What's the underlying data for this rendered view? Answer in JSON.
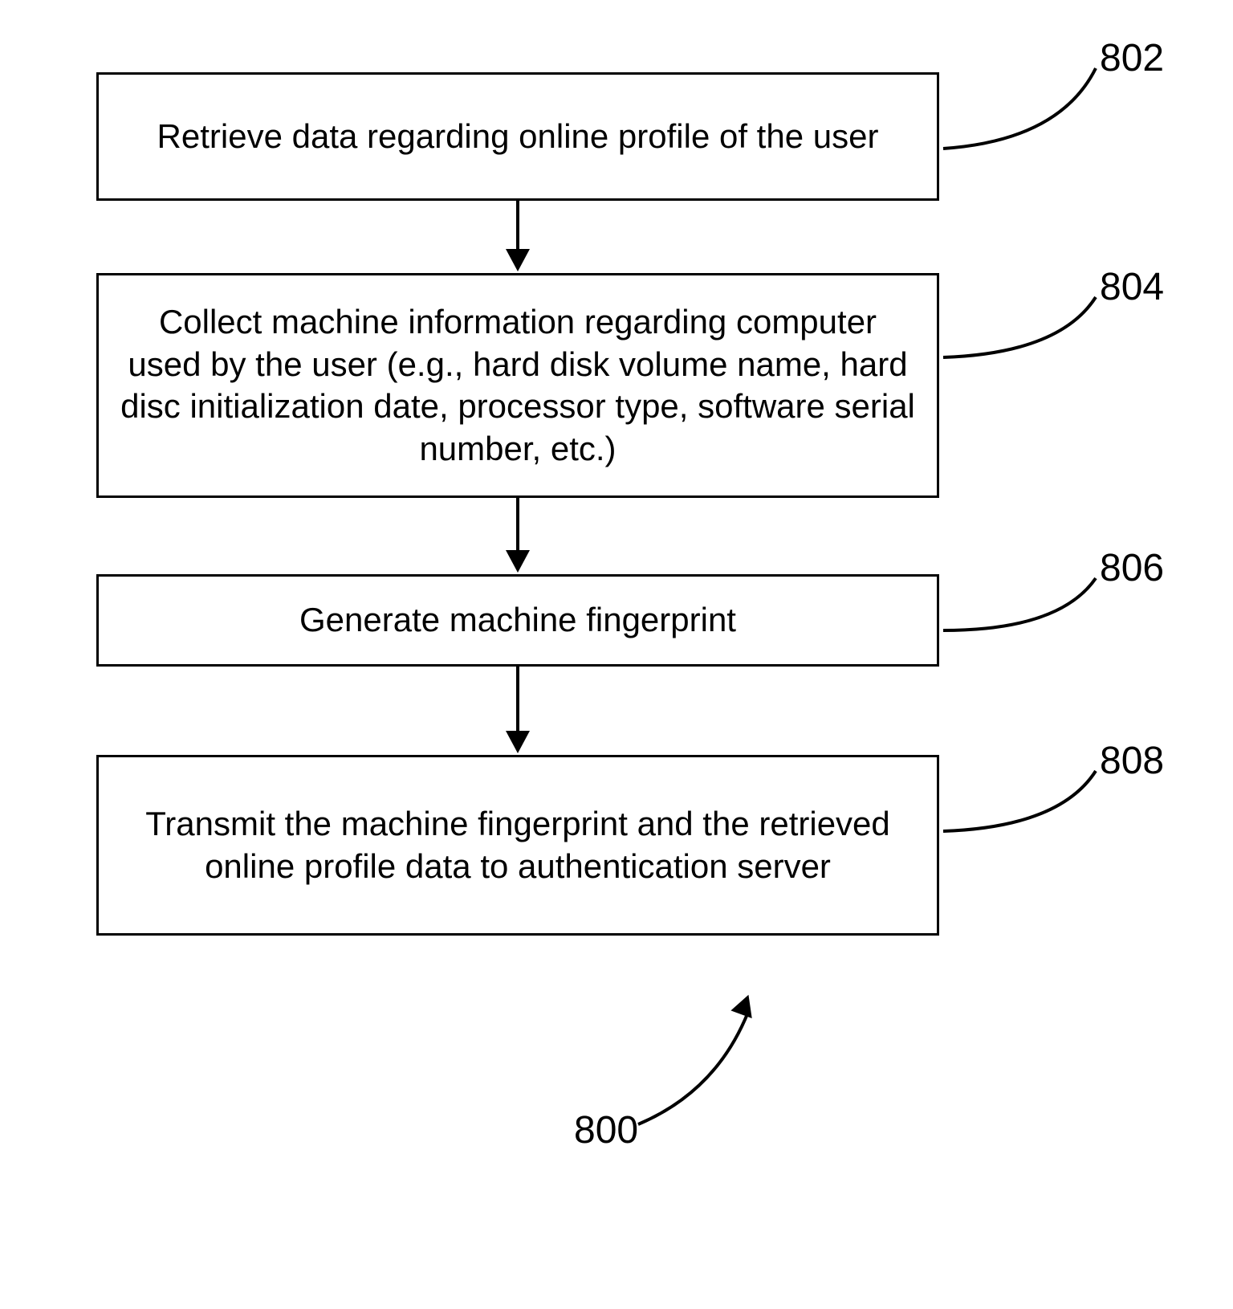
{
  "steps": [
    {
      "id": "802",
      "text": "Retrieve data regarding online profile of the user"
    },
    {
      "id": "804",
      "text": "Collect machine information regarding computer used by the user (e.g., hard disk volume name, hard disc initialization date, processor type, software serial number, etc.)"
    },
    {
      "id": "806",
      "text": "Generate machine fingerprint"
    },
    {
      "id": "808",
      "text": "Transmit the machine fingerprint and the retrieved online profile data to authentication server"
    }
  ],
  "diagram_label": "800"
}
